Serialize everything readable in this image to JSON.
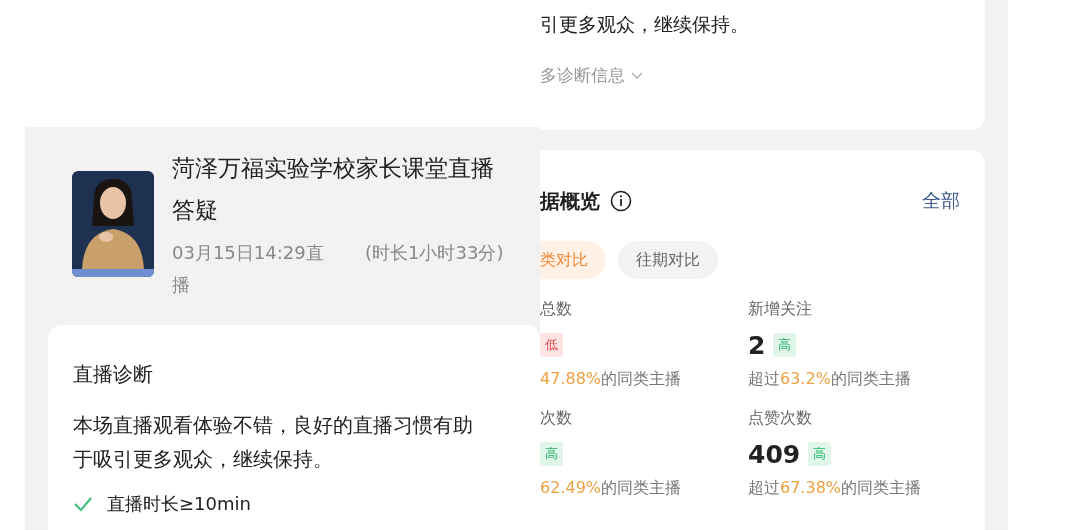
{
  "back_page": {
    "diagnosis_card": {
      "summary_tail": "引更多观众，继续保持。",
      "more_link": "多诊断信息"
    },
    "overview": {
      "title": "据概览",
      "all_link": "全部",
      "tabs": [
        {
          "label": "类对比",
          "selected": true
        },
        {
          "label": "往期对比",
          "selected": false
        }
      ],
      "metrics": [
        {
          "label": "总数",
          "badge": "低",
          "kind": "low",
          "percent": "47.88%",
          "suffix": "的同类主播"
        },
        {
          "label": "新增关注",
          "value": "2",
          "badge": "高",
          "kind": "high",
          "prefix": "超过",
          "percent": "63.2%",
          "suffix": "的同类主播"
        },
        {
          "label": "次数",
          "badge": "高",
          "kind": "high",
          "percent": "62.49%",
          "suffix": "的同类主播"
        },
        {
          "label": "点赞次数",
          "value": "409",
          "badge": "高",
          "kind": "high",
          "prefix": "超过",
          "percent": "67.38%",
          "suffix": "的同类主播"
        }
      ]
    }
  },
  "live_panel": {
    "title": "菏泽万福实验学校家长课堂直播答疑",
    "start": "03月15日14:29直播",
    "duration": "(时长1小时33分)",
    "diagnosis": {
      "heading": "直播诊断",
      "summary": "本场直播观看体验不错，良好的直播习惯有助于吸引更多观众，继续保持。",
      "checks": [
        {
          "label": "直播时长≥10min",
          "passed": true
        }
      ]
    }
  }
}
